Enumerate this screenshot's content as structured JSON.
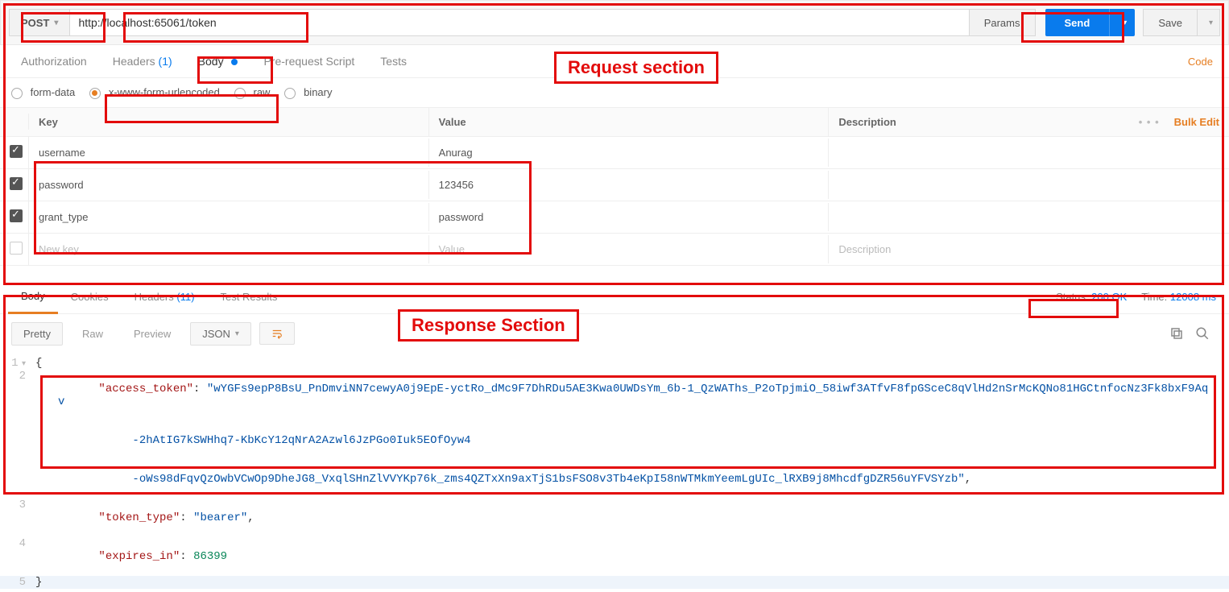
{
  "request": {
    "method": "POST",
    "url": "http://localhost:65061/token",
    "paramsLabel": "Params",
    "sendLabel": "Send",
    "saveLabel": "Save"
  },
  "reqTabs": {
    "authorization": "Authorization",
    "headers": "Headers",
    "headersCount": "(1)",
    "body": "Body",
    "prerequest": "Pre-request Script",
    "tests": "Tests",
    "codeLink": "Code"
  },
  "bodyTypes": {
    "formdata": "form-data",
    "urlencoded": "x-www-form-urlencoded",
    "raw": "raw",
    "binary": "binary"
  },
  "kvHeaders": {
    "key": "Key",
    "value": "Value",
    "description": "Description",
    "bulkEdit": "Bulk Edit"
  },
  "kvPlaceholders": {
    "key": "New key",
    "value": "Value",
    "description": "Description"
  },
  "kvRows": [
    {
      "key": "username",
      "value": "Anurag"
    },
    {
      "key": "password",
      "value": "123456"
    },
    {
      "key": "grant_type",
      "value": "password"
    }
  ],
  "annotations": {
    "requestLabel": "Request section",
    "responseLabel": "Response Section"
  },
  "response": {
    "tabs": {
      "body": "Body",
      "cookies": "Cookies",
      "headers": "Headers",
      "headersCount": "(11)",
      "testResults": "Test Results"
    },
    "statusLabel": "Status:",
    "statusValue": "200 OK",
    "timeLabel": "Time:",
    "timeValue": "12008 ms",
    "controls": {
      "pretty": "Pretty",
      "raw": "Raw",
      "preview": "Preview",
      "format": "JSON"
    },
    "json": {
      "line1": "{",
      "line2_key": "\"access_token\"",
      "line2_val_a": "\"wYGFs9epP8BsU_PnDmviNN7cewyA0j9EpE-yctRo_dMc9F7DhRDu5AE3Kwa0UWDsYm_6b-1_QzWAThs_P2oTpjmiO_58iwf3ATfvF8fpGSceC8qVlHd2nSrMcKQNo81HGCtnfocNz3Fk8bxF9Aqv",
      "line2_val_b": "-2hAtIG7kSWHhq7-KbKcY12qNrA2Azwl6JzPGo0Iuk5EOfOyw4",
      "line2_val_c": "-oWs98dFqvQzOwbVCwOp9DheJG8_VxqlSHnZlVVYKp76k_zms4QZTxXn9axTjS1bsFSO8v3Tb4eKpI58nWTMkmYeemLgUIc_lRXB9j8MhcdfgDZR56uYFVSYzb\"",
      "line3_key": "\"token_type\"",
      "line3_val": "\"bearer\"",
      "line4_key": "\"expires_in\"",
      "line4_val": "86399",
      "line5": "}"
    }
  }
}
